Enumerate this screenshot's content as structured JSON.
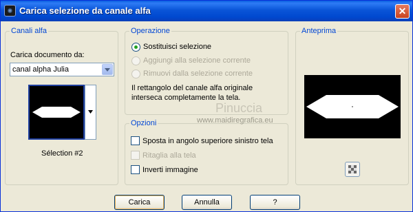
{
  "window": {
    "title": "Carica selezione da canale alfa",
    "close_symbol": "✕"
  },
  "canali": {
    "group_title": "Canali alfa",
    "document_label": "Carica documento da:",
    "document_value": "canal alpha Julia",
    "selection_name": "Sélection #2"
  },
  "operazione": {
    "group_title": "Operazione",
    "options": [
      {
        "label": "Sostituisci selezione",
        "selected": true,
        "enabled": true
      },
      {
        "label": "Aggiungi alla selezione corrente",
        "selected": false,
        "enabled": false
      },
      {
        "label": "Rimuovi dalla selezione corrente",
        "selected": false,
        "enabled": false
      }
    ],
    "info_line1": "Il rettangolo del canale alfa originale",
    "info_line2": "interseca completamente la tela."
  },
  "opzioni": {
    "group_title": "Opzioni",
    "items": [
      {
        "label": "Sposta in angolo superiore sinistro tela",
        "checked": false,
        "enabled": true
      },
      {
        "label": "Ritaglia alla tela",
        "checked": false,
        "enabled": false
      },
      {
        "label": "Inverti immagine",
        "checked": false,
        "enabled": true
      }
    ]
  },
  "anteprima": {
    "group_title": "Anteprima"
  },
  "watermark": {
    "line1": "Pinuccia",
    "line2": "www.maidiregrafica.eu"
  },
  "buttons": {
    "load": "Carica",
    "cancel": "Annulla",
    "help": "?"
  }
}
